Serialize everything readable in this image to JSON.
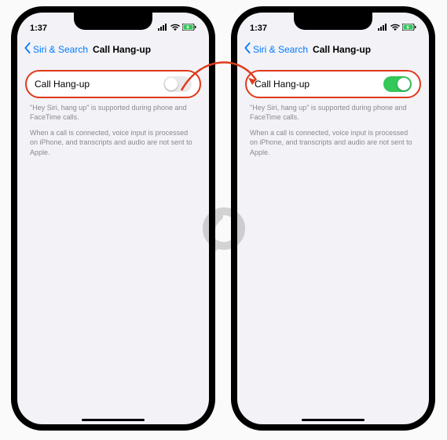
{
  "status": {
    "time": "1:37"
  },
  "nav": {
    "back_label": "Siri & Search",
    "title": "Call Hang-up"
  },
  "row": {
    "label": "Call Hang-up"
  },
  "footer": {
    "p1": "\"Hey Siri, hang up\" is supported during phone and FaceTime calls.",
    "p2": "When a call is connected, voice input is processed on iPhone, and transcripts and audio are not sent to Apple."
  },
  "left": {
    "toggle_on": false
  },
  "right": {
    "toggle_on": true
  },
  "colors": {
    "accent": "#007aff",
    "on": "#34c759",
    "highlight": "#e03a1a"
  }
}
